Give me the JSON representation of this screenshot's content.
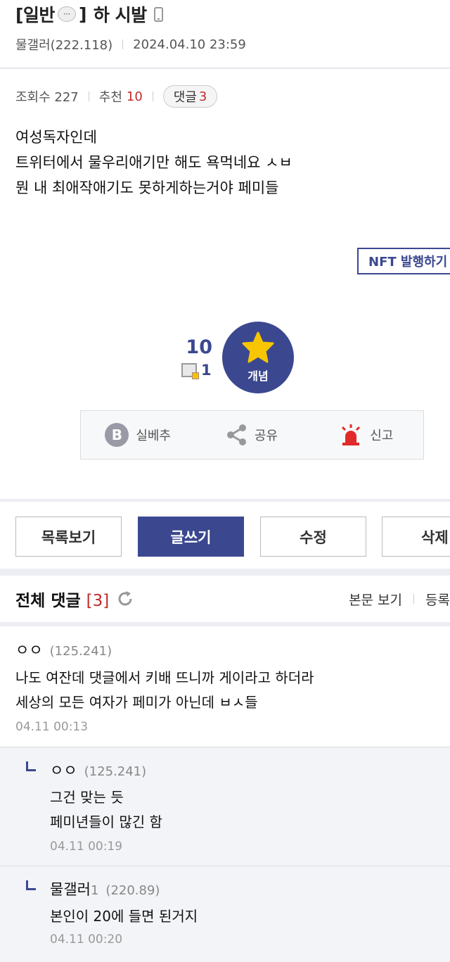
{
  "post": {
    "category": "[일반",
    "category_close": "]",
    "bubble_glyph": "···",
    "title": "하 시발",
    "author": "물갤러(222.118)",
    "date": "2024.04.10 23:59",
    "views_label": "조회수 227",
    "recommend_label": "추천",
    "recommend_value": "10",
    "comment_label": "댓글",
    "comment_value": "3",
    "body": [
      "여성독자인데",
      "트위터에서 물우리애기만 해도 욕먹네요 ㅅㅂ",
      "뭔 내 최애작애기도 못하게하는거야 페미들"
    ],
    "nft_button": "NFT 발행하기",
    "recommend_count": "10",
    "nft_count": "1",
    "gaenyeom_label": "개념"
  },
  "share_bar": {
    "silbe_label": "실베추",
    "b_glyph": "B",
    "share_label": "공유",
    "report_label": "신고"
  },
  "buttons": {
    "list": "목록보기",
    "write": "글쓰기",
    "edit": "수정",
    "delete": "삭제"
  },
  "comments_header": {
    "title": "전체 댓글",
    "count": "[3]",
    "view_body": "본문 보기",
    "register": "등록"
  },
  "comments": [
    {
      "nick": "ㅇㅇ",
      "ip": "(125.241)",
      "lines": [
        "나도 여잔데 댓글에서 키배 뜨니까 게이라고 하더라",
        "세상의 모든 여자가 페미가 아닌데 ㅂㅅ들"
      ],
      "date": "04.11 00:13"
    },
    {
      "nick": "ㅇㅇ",
      "ip": "(125.241)",
      "lines": [
        "그건 맞는 듯",
        "페미년들이 많긴 함"
      ],
      "date": "04.11 00:19"
    },
    {
      "nick": "물갤러",
      "nick_suffix": "1",
      "ip": "(220.89)",
      "lines": [
        "본인이 20에 들면 된거지"
      ],
      "date": "04.11 00:20"
    }
  ],
  "colors": {
    "accent": "#3b4890",
    "red": "#c12b2b",
    "report_red": "#e02a2a",
    "star": "#f7c600"
  },
  "icons": [
    "speech-bubble-icon",
    "mobile-phone-icon",
    "nft-icon",
    "star-icon",
    "b-icon",
    "share-icon",
    "siren-icon",
    "refresh-icon",
    "reply-arrow-icon"
  ]
}
